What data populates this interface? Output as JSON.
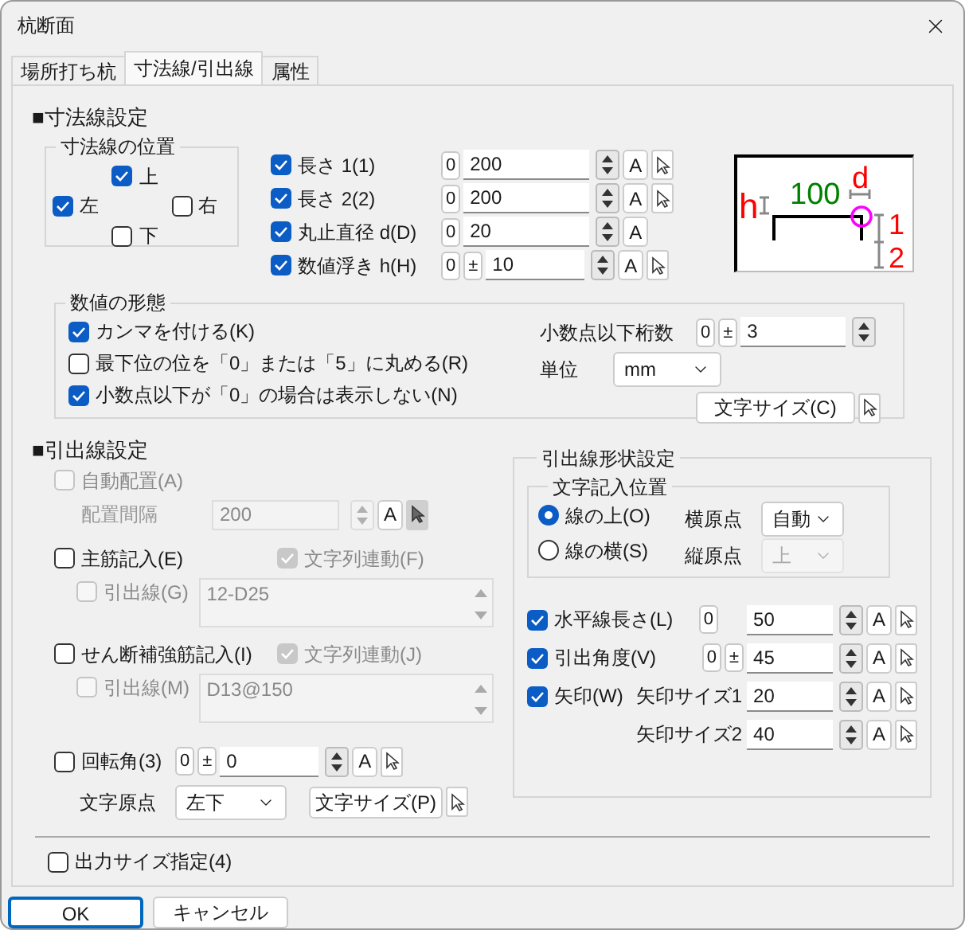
{
  "window": {
    "title": "杭断面"
  },
  "tabs": [
    {
      "label": "場所打ち杭",
      "selected": false
    },
    {
      "label": "寸法線/引出線",
      "selected": true
    },
    {
      "label": "属性",
      "selected": false
    }
  ],
  "dimension": {
    "heading": "■寸法線設定",
    "position_group": {
      "title": "寸法線の位置",
      "options": [
        {
          "label": "上",
          "kind": "top",
          "checked": true
        },
        {
          "label": "左",
          "kind": "left",
          "checked": true
        },
        {
          "label": "右",
          "kind": "right",
          "checked": false
        },
        {
          "label": "下",
          "kind": "bottom",
          "checked": false
        }
      ]
    },
    "rows": [
      {
        "label": "長さ 1(1)",
        "checked": true,
        "zero": "0",
        "value": "200",
        "font_button": "A",
        "pick": true
      },
      {
        "label": "長さ 2(2)",
        "checked": true,
        "zero": "0",
        "value": "200",
        "font_button": "A",
        "pick": true
      },
      {
        "label": "丸止直径 d(D)",
        "checked": true,
        "zero": "0",
        "value": "20",
        "font_button": "A",
        "pick": false
      },
      {
        "label": "数値浮き h(H)",
        "checked": true,
        "zero": "0",
        "sign": "±",
        "value": "10",
        "font_button": "A",
        "pick": true
      }
    ],
    "diagram": {
      "h": "h",
      "length": "100",
      "d": "d",
      "one": "1",
      "two": "2"
    }
  },
  "number_format": {
    "title": "数値の形態",
    "options": [
      {
        "label": "カンマを付ける(K)",
        "checked": true
      },
      {
        "label": "最下位の位を「0」または「5」に丸める(R)",
        "checked": false
      },
      {
        "label": "小数点以下が「0」の場合は表示しない(N)",
        "checked": true
      }
    ],
    "decimals": {
      "label": "小数点以下桁数",
      "zero": "0",
      "sign": "±",
      "value": "3"
    },
    "unit": {
      "label": "単位",
      "value": "mm"
    },
    "font_size_button": "文字サイズ(C)"
  },
  "leader": {
    "heading": "■引出線設定",
    "auto": {
      "label": "自動配置(A)",
      "checked": false,
      "spacing_label": "配置間隔",
      "spacing_value": "200",
      "font_button": "A",
      "disabled": true
    },
    "bars": [
      {
        "label": "主筋記入(E)",
        "checked": false,
        "link": {
          "label": "文字列連動(F)",
          "checked": true,
          "disabled": true
        },
        "leader": {
          "label": "引出線(G)",
          "checked": false,
          "disabled": true
        },
        "text": "12-D25"
      },
      {
        "label": "せん断補強筋記入(I)",
        "checked": false,
        "link": {
          "label": "文字列連動(J)",
          "checked": true,
          "disabled": true
        },
        "leader": {
          "label": "引出線(M)",
          "checked": false,
          "disabled": true
        },
        "text": "D13@150"
      }
    ],
    "rotation": {
      "label": "回転角(3)",
      "checked": false,
      "zero": "0",
      "sign": "±",
      "value": "0",
      "font_button": "A",
      "pick": true
    },
    "text_origin": {
      "label": "文字原点",
      "value": "左下",
      "font_size_button": "文字サイズ(P)"
    }
  },
  "shape": {
    "title": "引出線形状設定",
    "position": {
      "title": "文字記入位置",
      "radios": [
        {
          "label": "線の上(O)",
          "selected": true
        },
        {
          "label": "線の横(S)",
          "selected": false
        }
      ],
      "origins": [
        {
          "label": "横原点",
          "value": "自動",
          "disabled": false
        },
        {
          "label": "縦原点",
          "value": "上",
          "disabled": true
        }
      ]
    },
    "rows": [
      {
        "label": "水平線長さ(L)",
        "checked": true,
        "zero": "0",
        "value": "50",
        "font_button": "A"
      },
      {
        "label": "引出角度(V)",
        "checked": true,
        "zero": "0",
        "sign": "±",
        "value": "45",
        "font_button": "A"
      },
      {
        "label": "矢印(W)",
        "checked": true,
        "sub_label": "矢印サイズ1",
        "value": "20",
        "font_button": "A"
      },
      {
        "sub_label": "矢印サイズ2",
        "value": "40",
        "font_button": "A"
      }
    ]
  },
  "output_size": {
    "label": "出力サイズ指定(4)",
    "checked": false
  },
  "buttons": [
    {
      "label": "OK",
      "default": true
    },
    {
      "label": "キャンセル",
      "default": false
    }
  ]
}
